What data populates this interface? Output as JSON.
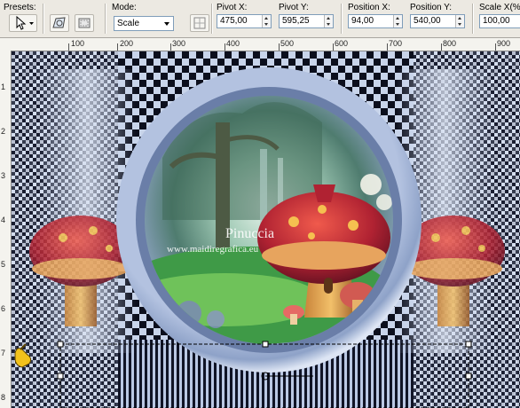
{
  "toolbar": {
    "presets_label": "Presets:",
    "mode_label": "Mode:",
    "mode_value": "Scale",
    "pivot_x_label": "Pivot X:",
    "pivot_x_value": "475,00",
    "pivot_y_label": "Pivot Y:",
    "pivot_y_value": "595,25",
    "position_x_label": "Position X:",
    "position_x_value": "94,00",
    "position_y_label": "Position Y:",
    "position_y_value": "540,00",
    "scale_x_label": "Scale X(%",
    "scale_x_value": "100,00"
  },
  "ruler": {
    "h_labels": [
      "100",
      "200",
      "300",
      "400",
      "500",
      "600",
      "700",
      "800",
      "900"
    ],
    "v_labels": [
      "1",
      "2",
      "3",
      "4",
      "5",
      "6",
      "7",
      "8"
    ]
  },
  "watermark": {
    "title": "Pinuccia",
    "url": "www.maidiregrafica.eu"
  },
  "icons": [
    "pointer-icon",
    "cursor-dropdown-icon",
    "deform-icon",
    "reset-icon",
    "grid-icon",
    "hand-pointer-icon"
  ],
  "colors": {
    "toolbar_bg": "#ece9e2",
    "ring": "#a7b6d6",
    "checker_light": "#c8d4ea",
    "checker_dark": "#0c0f1d"
  }
}
